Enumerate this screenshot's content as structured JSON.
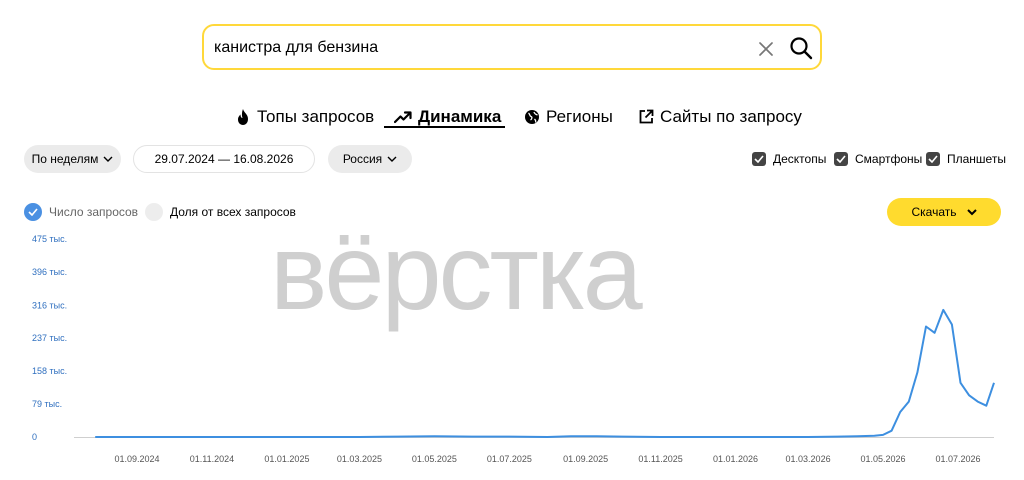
{
  "search": {
    "value": "канистра для бензина",
    "icons": {
      "clear": "close-icon",
      "submit": "search-icon"
    }
  },
  "tabs": [
    {
      "label": "Топы запросов",
      "icon": "fire-icon",
      "active": false
    },
    {
      "label": "Динамика",
      "icon": "trend-up-icon",
      "active": true
    },
    {
      "label": "Регионы",
      "icon": "globe-icon",
      "active": false
    },
    {
      "label": "Сайты по запросу",
      "icon": "external-link-icon",
      "active": false
    }
  ],
  "filters": {
    "period": "По неделям",
    "date_range": "29.07.2024 — 16.08.2026",
    "region": "Россия"
  },
  "devices": [
    {
      "label": "Десктопы",
      "checked": true
    },
    {
      "label": "Смартфоны",
      "checked": true
    },
    {
      "label": "Планшеты",
      "checked": true
    }
  ],
  "legend": {
    "count": {
      "label": "Число запросов",
      "checked": true
    },
    "share": {
      "label": "Доля от всех запросов",
      "checked": false
    }
  },
  "download_label": "Скачать",
  "watermark": "вёрстка",
  "colors": {
    "accent_yellow": "#ffdb2e",
    "search_border": "#ffd83a",
    "line": "#3d8fe0",
    "axis_label": "#2f6fbf"
  },
  "chart_data": {
    "type": "line",
    "ylim": [
      0,
      475
    ],
    "y_tick_values": [
      0,
      79,
      158,
      237,
      316,
      396,
      475
    ],
    "y_tick_labels": [
      "0",
      "79 тыс.",
      "158 тыс.",
      "237 тыс.",
      "316 тыс.",
      "396 тыс.",
      "475 тыс."
    ],
    "x_ticks": [
      "01.09.2024",
      "01.11.2024",
      "01.01.2025",
      "01.03.2025",
      "01.05.2025",
      "01.07.2025",
      "01.09.2025",
      "01.11.2025",
      "01.01.2026",
      "01.03.2026",
      "01.05.2026",
      "01.07.2026"
    ],
    "series": [
      {
        "points": [
          [
            "2024-07-29",
            0
          ],
          [
            "2024-09-01",
            0
          ],
          [
            "2024-10-01",
            0
          ],
          [
            "2024-11-01",
            0
          ],
          [
            "2024-12-01",
            0
          ],
          [
            "2025-01-01",
            0
          ],
          [
            "2025-02-01",
            0
          ],
          [
            "2025-03-01",
            0
          ],
          [
            "2025-04-01",
            1
          ],
          [
            "2025-05-01",
            2
          ],
          [
            "2025-06-01",
            1
          ],
          [
            "2025-07-01",
            1
          ],
          [
            "2025-08-01",
            0
          ],
          [
            "2025-08-20",
            2
          ],
          [
            "2025-09-10",
            2
          ],
          [
            "2025-10-01",
            1
          ],
          [
            "2025-11-01",
            0
          ],
          [
            "2025-12-01",
            0
          ],
          [
            "2026-01-01",
            0
          ],
          [
            "2026-02-01",
            0
          ],
          [
            "2026-03-01",
            0
          ],
          [
            "2026-03-25",
            1
          ],
          [
            "2026-04-10",
            2
          ],
          [
            "2026-04-24",
            3
          ],
          [
            "2026-05-01",
            5
          ],
          [
            "2026-05-08",
            15
          ],
          [
            "2026-05-15",
            60
          ],
          [
            "2026-05-22",
            85
          ],
          [
            "2026-05-29",
            155
          ],
          [
            "2026-06-05",
            265
          ],
          [
            "2026-06-12",
            250
          ],
          [
            "2026-06-19",
            305
          ],
          [
            "2026-06-26",
            270
          ],
          [
            "2026-07-03",
            130
          ],
          [
            "2026-07-10",
            100
          ],
          [
            "2026-07-17",
            85
          ],
          [
            "2026-07-24",
            75
          ],
          [
            "2026-08-01",
            130
          ]
        ]
      }
    ]
  }
}
